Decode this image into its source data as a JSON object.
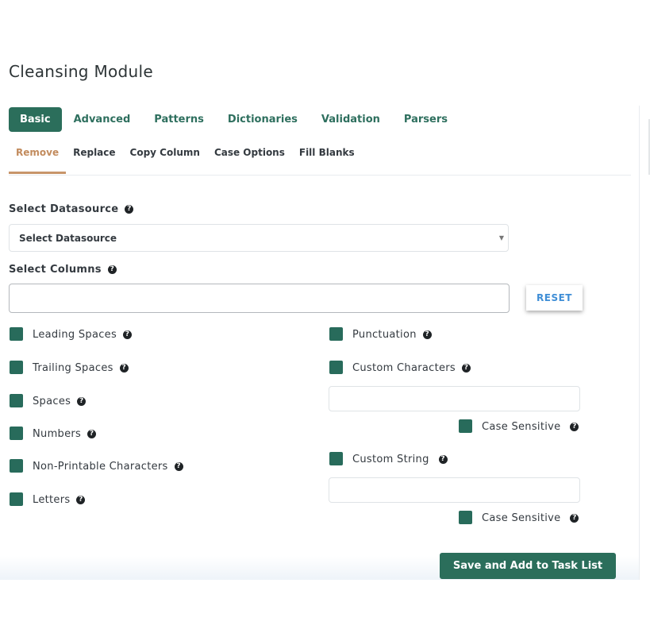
{
  "title": "Cleansing Module",
  "tabs": [
    {
      "label": "Basic",
      "active": true
    },
    {
      "label": "Advanced"
    },
    {
      "label": "Patterns"
    },
    {
      "label": "Dictionaries"
    },
    {
      "label": "Validation"
    },
    {
      "label": "Parsers"
    }
  ],
  "subtabs": [
    {
      "label": "Remove",
      "active": true
    },
    {
      "label": "Replace"
    },
    {
      "label": "Copy Column"
    },
    {
      "label": "Case Options"
    },
    {
      "label": "Fill Blanks"
    }
  ],
  "datasource": {
    "label": "Select Datasource",
    "selected": "Select Datasource"
  },
  "columns": {
    "label": "Select Columns",
    "value": "",
    "reset_label": "RESET"
  },
  "options_left": [
    {
      "label": "Leading Spaces",
      "checked": true
    },
    {
      "label": "Trailing Spaces",
      "checked": true
    },
    {
      "label": "Spaces",
      "checked": true
    },
    {
      "label": "Numbers",
      "checked": true
    },
    {
      "label": "Non-Printable Characters",
      "checked": true
    },
    {
      "label": "Letters",
      "checked": true
    }
  ],
  "options_right": {
    "punctuation": {
      "label": "Punctuation",
      "checked": true
    },
    "custom_characters": {
      "label": "Custom Characters",
      "checked": true,
      "value": "",
      "case_sensitive": {
        "label": "Case Sensitive",
        "checked": true
      }
    },
    "custom_string": {
      "label": "Custom String",
      "checked": true,
      "value": "",
      "case_sensitive": {
        "label": "Case Sensitive",
        "checked": true
      }
    }
  },
  "help_glyph": "?",
  "save_label": "Save and Add to Task List",
  "colors": {
    "primary": "#2b6e5b",
    "accent": "#c8956a",
    "link": "#3f8ed6"
  }
}
